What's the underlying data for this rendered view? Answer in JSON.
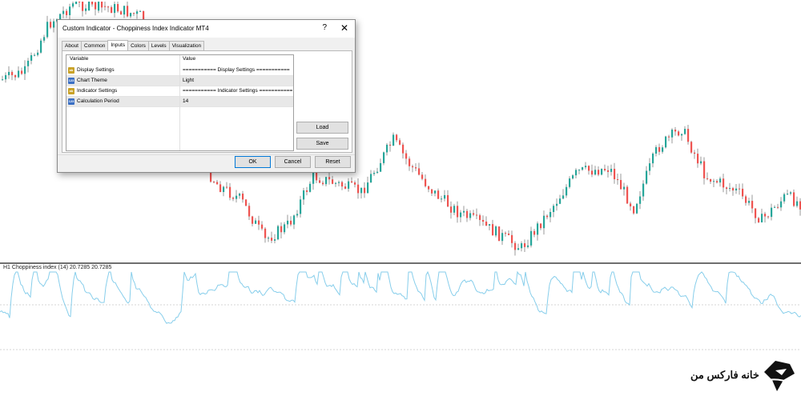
{
  "chart": {
    "indicator_label": "H1 Choppiness index (14) 20.7285 20.7285",
    "colors": {
      "bull": "#26a69a",
      "bear": "#ef5350",
      "wick": "#555555",
      "indicator": "#87ceeb",
      "level": "#c8c8c8"
    }
  },
  "dialog": {
    "title": "Custom Indicator - Choppiness Index Indicator MT4",
    "help_label": "?",
    "close_label": "✕",
    "tabs": [
      {
        "label": "About"
      },
      {
        "label": "Common"
      },
      {
        "label": "Inputs",
        "active": true
      },
      {
        "label": "Colors"
      },
      {
        "label": "Levels"
      },
      {
        "label": "Visualization"
      }
    ],
    "grid": {
      "headers": {
        "variable": "Variable",
        "value": "Value"
      },
      "rows": [
        {
          "icon": "ab",
          "variable": "Display Settings",
          "value": "=========== Display Settings ==========="
        },
        {
          "icon": "123",
          "variable": "Chart Theme",
          "value": "Light"
        },
        {
          "icon": "ab",
          "variable": "Indicator Settings",
          "value": "=========== Indicator Settings ==========="
        },
        {
          "icon": "123",
          "variable": "Calculation Period",
          "value": "14"
        }
      ]
    },
    "buttons": {
      "load": "Load",
      "save": "Save",
      "ok": "OK",
      "cancel": "Cancel",
      "reset": "Reset"
    }
  },
  "watermark": {
    "text": "خانه فارکس من",
    "icon": "fox-logo-icon"
  }
}
